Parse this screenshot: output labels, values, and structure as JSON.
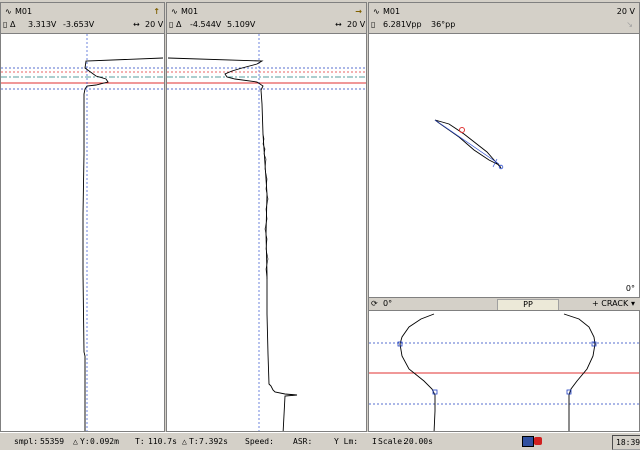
{
  "panel1": {
    "title": "M01",
    "val1": "3.313V",
    "val2": "-3.653V",
    "scale": "20 V"
  },
  "panel2": {
    "title": "M01",
    "val1": "-4.544V",
    "val2": "5.109V",
    "scale": "20 V"
  },
  "panel3": {
    "title": "M01",
    "vpp": "6.281Vpp",
    "angle": "36°pp",
    "scale": "20 V",
    "rotation": "0°",
    "rot_field": "0°",
    "mode": "PP",
    "probe": "+ CRACK"
  },
  "statusbar": {
    "smpl_label": "smpl:",
    "smpl_value": "55359",
    "y_label": "Y:",
    "y_value": "0.092m",
    "t_label": "T:",
    "t_value": "110.7s",
    "dt_label": "T:",
    "dt_value": "7.392s",
    "speed_label": "Speed:",
    "asr_label": "ASR:",
    "ylim_label": "Y Lm:",
    "scale_label": "Scale:",
    "scale_value": "20.00s",
    "time": "18:39"
  },
  "colors": {
    "trace": "#000000",
    "red_ref": "#e03030",
    "blue_ref": "#2040c0",
    "cursor": "#3050d0",
    "bg": "#d4d0c8"
  }
}
